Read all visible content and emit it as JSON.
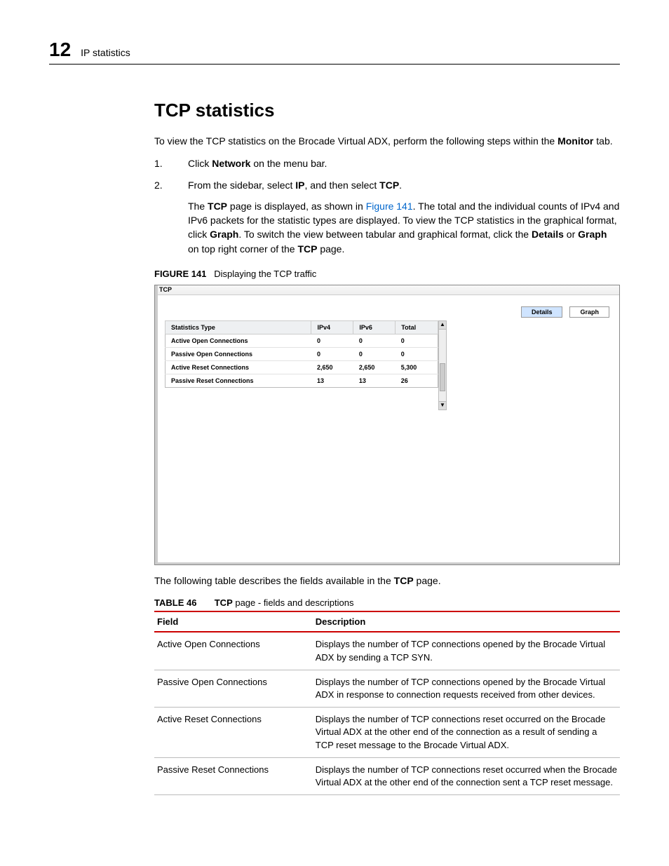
{
  "header": {
    "chapter": "12",
    "section": "IP statistics"
  },
  "title": "TCP statistics",
  "intro": {
    "pre": "To view the TCP statistics on the Brocade Virtual ADX, perform the following steps within the ",
    "bold": "Monitor",
    "post": " tab."
  },
  "steps": {
    "s1": {
      "num": "1.",
      "pre": "Click ",
      "b1": "Network",
      "post": " on the menu bar."
    },
    "s2": {
      "num": "2.",
      "pre": "From the sidebar, select ",
      "b1": "IP",
      "mid": ", and then select ",
      "b2": "TCP",
      "post": "."
    },
    "s2body": {
      "a": "The ",
      "b1": "TCP",
      "c": " page is displayed, as shown in ",
      "link": "Figure 141",
      "d": ". The total and the individual counts of IPv4 and IPv6 packets for the statistic types are displayed. To view the TCP statistics in the graphical format, click ",
      "b2": "Graph",
      "e": ". To switch the view between tabular and graphical format, click the ",
      "b3": "Details",
      "f": " or ",
      "b4": "Graph",
      "g": " on top right corner of the ",
      "b5": "TCP",
      "h": " page."
    }
  },
  "figure": {
    "label": "FIGURE 141",
    "caption": "Displaying the TCP traffic",
    "panel_title": "TCP",
    "tabs": {
      "details": "Details",
      "graph": "Graph"
    },
    "headers": {
      "c1": "Statistics Type",
      "c2": "IPv4",
      "c3": "IPv6",
      "c4": "Total"
    },
    "rows": [
      {
        "c1": "Active Open Connections",
        "c2": "0",
        "c3": "0",
        "c4": "0"
      },
      {
        "c1": "Passive Open Connections",
        "c2": "0",
        "c3": "0",
        "c4": "0"
      },
      {
        "c1": "Active Reset Connections",
        "c2": "2,650",
        "c3": "2,650",
        "c4": "5,300"
      },
      {
        "c1": "Passive Reset Connections",
        "c2": "13",
        "c3": "13",
        "c4": "26"
      }
    ]
  },
  "after_figure": {
    "pre": "The following table describes the fields available in the ",
    "b": "TCP",
    "post": " page."
  },
  "table46": {
    "label": "TABLE 46",
    "caption_b": "TCP",
    "caption_rest": " page - fields and descriptions",
    "head": {
      "c1": "Field",
      "c2": "Description"
    },
    "rows": [
      {
        "f": "Active Open Connections",
        "d": "Displays the number of TCP connections opened by the Brocade Virtual ADX by sending a TCP SYN."
      },
      {
        "f": "Passive Open Connections",
        "d": "Displays the number of TCP connections opened by the Brocade Virtual ADX in response to connection requests received from other devices."
      },
      {
        "f": "Active Reset Connections",
        "d": "Displays the number of TCP connections reset occurred on the Brocade Virtual ADX at the other end of the connection as a result of sending a TCP reset message to the Brocade Virtual ADX."
      },
      {
        "f": "Passive Reset Connections",
        "d": "Displays the number of TCP connections reset occurred when the Brocade Virtual ADX at the other end of the connection sent a TCP reset message."
      }
    ]
  }
}
